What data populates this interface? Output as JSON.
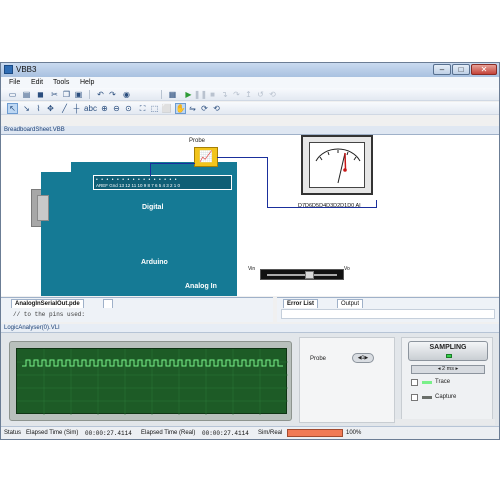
{
  "window": {
    "title": "VBB3"
  },
  "menu": [
    "File",
    "Edit",
    "Tools",
    "Help"
  ],
  "toolbar1": [
    "new-icon",
    "open-icon",
    "save-icon",
    "play-icon",
    "stop-icon",
    "step-icon"
  ],
  "toolbar2": [
    "pointer-icon",
    "wire-icon",
    "move-icon",
    "zoom-in-icon",
    "zoom-out-icon",
    "zoom-fit-icon",
    "hand-icon",
    "rotate-icon"
  ],
  "document_tab": "BreadboardSheet.VBB",
  "sheet": {
    "probe_label": "Probe",
    "board_digital_label": "Digital",
    "board_name": "Arduino",
    "board_analog_label": "Analog In",
    "header_pins": "AREF Gnd 13 12 11 10 9 8 7 6 5 4 3 2 1 0",
    "meter_pins": "D7D6D5D4D3D2D1D0  AI",
    "slider_left_label": "Vin",
    "slider_right_label": "Vo"
  },
  "code_pane": {
    "tab": "AnalogInSerialOut.pde",
    "line": "// to the pins used:"
  },
  "error_pane": {
    "tabs": [
      "Error List",
      "Output"
    ]
  },
  "logic_analyser": {
    "title": "LogicAnalyser(0).VLI",
    "probe_label": "Probe",
    "probe_value": "1",
    "sampling_label": "SAMPLING",
    "rate": "2 ms",
    "trace_label": "Trace",
    "capture_label": "Capture"
  },
  "status": {
    "label": "Status",
    "elapsed_sim_label": "Elapsed Time (Sim)",
    "elapsed_sim_value": "00:00:27.4114",
    "elapsed_real_label": "Elapsed Time (Real)",
    "elapsed_real_value": "00:00:27.4114",
    "ratio_label": "Sim/Real",
    "percent": "100%"
  },
  "colors": {
    "board": "#157a95",
    "wire": "#1a2f9c",
    "scope": "#1d5b26",
    "trace": "#79f089",
    "progress": "#f07a55"
  }
}
